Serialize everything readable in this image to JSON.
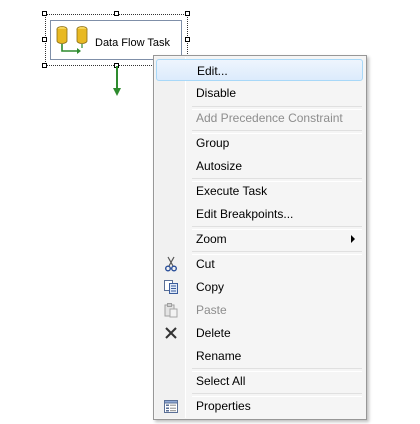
{
  "task": {
    "label": "Data Flow Task",
    "icon": "data-flow-task-icon"
  },
  "menu": {
    "items": [
      {
        "label": "Edit...",
        "enabled": true,
        "highlighted": true
      },
      {
        "label": "Disable",
        "enabled": true
      },
      {
        "label": "Add Precedence Constraint",
        "enabled": false
      },
      {
        "label": "Group",
        "enabled": true
      },
      {
        "label": "Autosize",
        "enabled": true
      },
      {
        "label": "Execute Task",
        "enabled": true
      },
      {
        "label": "Edit Breakpoints...",
        "enabled": true
      },
      {
        "label": "Zoom",
        "enabled": true,
        "submenu": true
      },
      {
        "label": "Cut",
        "enabled": true,
        "icon": "cut-icon"
      },
      {
        "label": "Copy",
        "enabled": true,
        "icon": "copy-icon"
      },
      {
        "label": "Paste",
        "enabled": false,
        "icon": "paste-icon"
      },
      {
        "label": "Delete",
        "enabled": true,
        "icon": "delete-icon"
      },
      {
        "label": "Rename",
        "enabled": true
      },
      {
        "label": "Select All",
        "enabled": true
      },
      {
        "label": "Properties",
        "enabled": true,
        "icon": "properties-icon"
      }
    ]
  },
  "colors": {
    "highlight_border": "#a8d8f8",
    "connector": "#2e8b2e",
    "disabled_text": "#8d8d8d"
  }
}
